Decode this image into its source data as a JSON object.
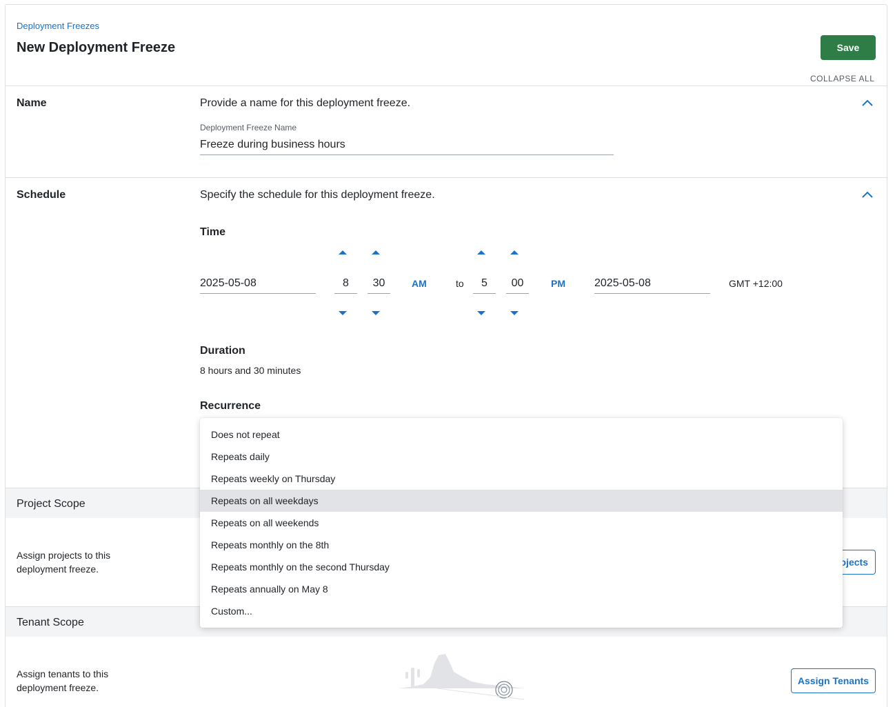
{
  "header": {
    "breadcrumb": "Deployment Freezes",
    "title": "New Deployment Freeze",
    "save_label": "Save",
    "collapse_all_label": "COLLAPSE ALL"
  },
  "name_section": {
    "label": "Name",
    "description": "Provide a name for this deployment freeze.",
    "field_label": "Deployment Freeze Name",
    "field_value": "Freeze during business hours"
  },
  "schedule_section": {
    "label": "Schedule",
    "description": "Specify the schedule for this deployment freeze.",
    "time_heading": "Time",
    "start": {
      "date": "2025-05-08",
      "hour": "8",
      "minute": "30",
      "period": "AM"
    },
    "to_label": "to",
    "end": {
      "date": "2025-05-08",
      "hour": "5",
      "minute": "00",
      "period": "PM"
    },
    "timezone": "GMT +12:00",
    "duration_heading": "Duration",
    "duration_value": "8 hours and 30 minutes",
    "recurrence_heading": "Recurrence"
  },
  "recurrence_dropdown": {
    "options": [
      "Does not repeat",
      "Repeats daily",
      "Repeats weekly on Thursday",
      "Repeats on all weekdays",
      "Repeats on all weekends",
      "Repeats monthly on the 8th",
      "Repeats monthly on the second Thursday",
      "Repeats annually on May 8",
      "Custom..."
    ],
    "highlighted": "Repeats on all weekdays"
  },
  "project_scope": {
    "title": "Project Scope",
    "description": "Assign projects to this deployment freeze.",
    "button_visible_text": "ojects"
  },
  "tenant_scope": {
    "title": "Tenant Scope",
    "description": "Assign tenants to this deployment freeze.",
    "button_label": "Assign Tenants"
  },
  "colors": {
    "accent": "#1a73c8",
    "save": "#2e7d46",
    "border": "#dcdfe4",
    "band": "#f3f4f6",
    "highlight": "#e1e3e7"
  },
  "icons": [
    "chevron-up-icon",
    "triangle-up-icon",
    "triangle-down-icon",
    "empty-state-illustration"
  ]
}
